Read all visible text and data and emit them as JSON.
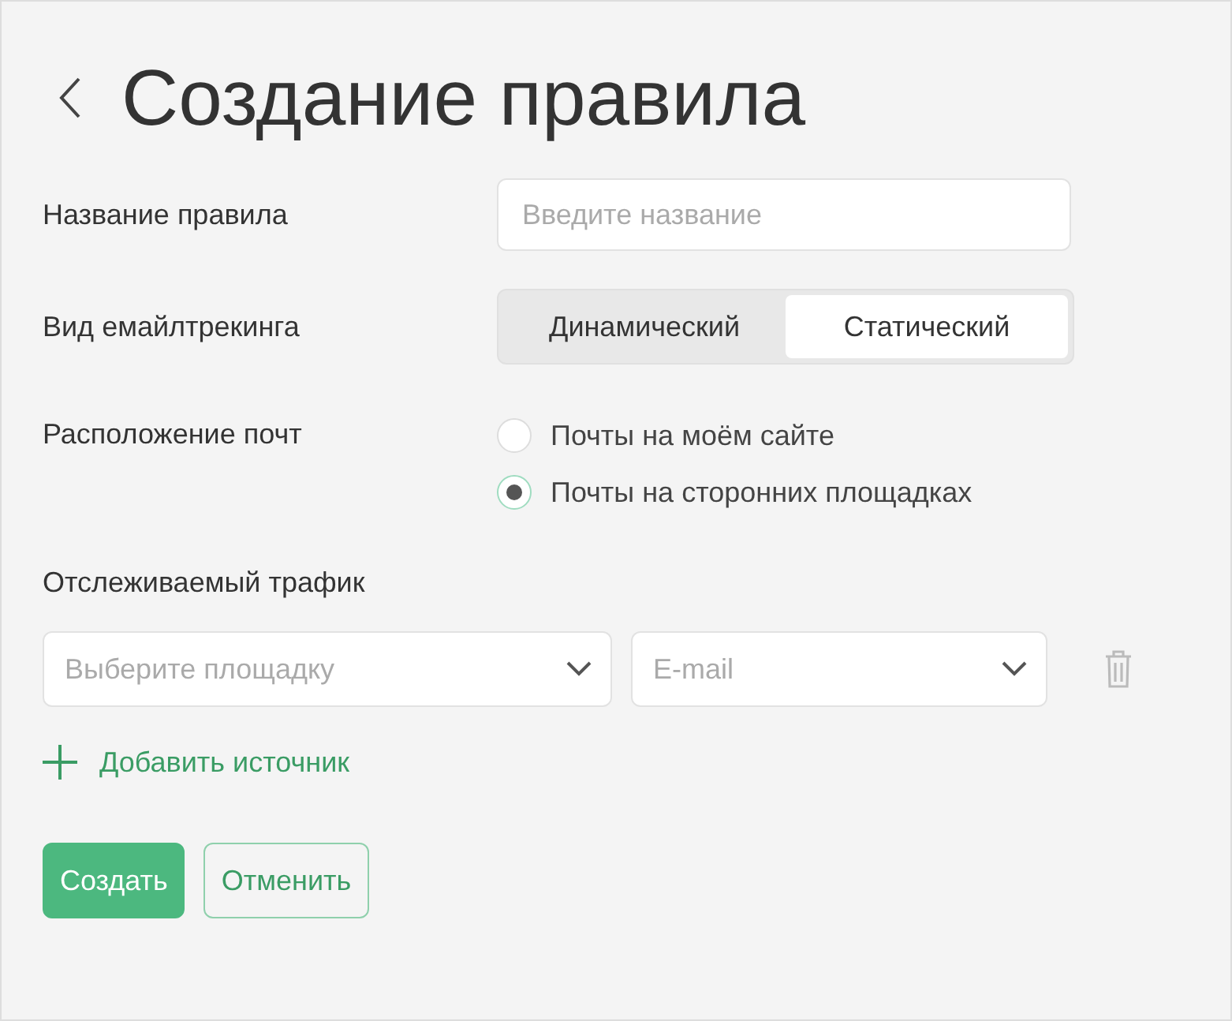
{
  "title": "Создание правила",
  "name_field": {
    "label": "Название правила",
    "placeholder": "Введите название"
  },
  "tracking_type": {
    "label": "Вид емайлтрекинга",
    "options": [
      {
        "label": "Динамический",
        "selected": false
      },
      {
        "label": "Статический",
        "selected": true
      }
    ]
  },
  "mail_location": {
    "label": "Расположение почт",
    "options": [
      {
        "label": "Почты на моём сайте",
        "selected": false
      },
      {
        "label": "Почты на сторонних площадках",
        "selected": true
      }
    ]
  },
  "traffic": {
    "label": "Отслеживаемый трафик",
    "platform_placeholder": "Выберите площадку",
    "channel_placeholder": "E-mail"
  },
  "add_source": "Добавить источник",
  "buttons": [
    {
      "label": "Создать",
      "kind": "primary"
    },
    {
      "label": "Отменить",
      "kind": "secondary"
    }
  ]
}
